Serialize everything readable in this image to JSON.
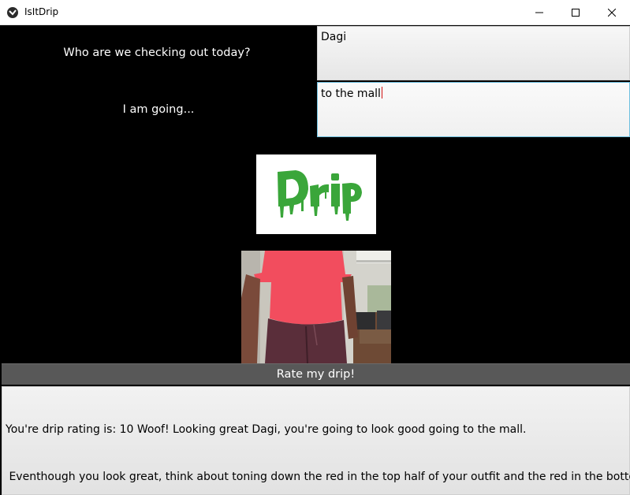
{
  "window": {
    "title": "IsItDrip",
    "controls": [
      "minimize-icon",
      "maximize-icon",
      "close-icon"
    ]
  },
  "form": {
    "name_prompt": "Who are we checking out today?",
    "name_value": "Dagi",
    "destination_prompt": "I am going...",
    "destination_value": "to the mall"
  },
  "logo": {
    "text": "Drip",
    "color": "#3aa63a"
  },
  "photo": {
    "description_icon": "outfit-photo"
  },
  "action": {
    "rate_label": "Rate my drip!"
  },
  "result": {
    "line1": "You're drip rating is: 10 Woof! Looking great Dagi, you're going to look good going to the mall.",
    "line2": " Eventhough you look great, think about toning down the red in the top half of your outfit and the red in the bottom half!"
  },
  "colors": {
    "background": "#000000",
    "button": "#585858",
    "focus_border": "#6ec0e0"
  }
}
